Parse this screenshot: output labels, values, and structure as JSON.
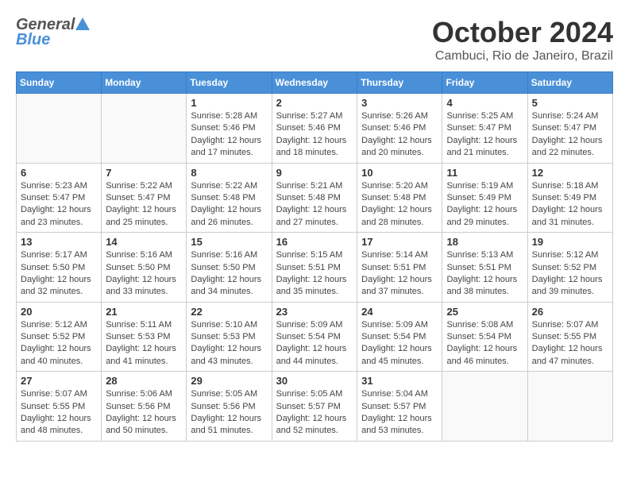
{
  "header": {
    "logo": {
      "general": "General",
      "blue": "Blue"
    },
    "title": "October 2024",
    "location": "Cambuci, Rio de Janeiro, Brazil"
  },
  "calendar": {
    "days": [
      "Sunday",
      "Monday",
      "Tuesday",
      "Wednesday",
      "Thursday",
      "Friday",
      "Saturday"
    ],
    "weeks": [
      [
        {
          "day": "",
          "sunrise": "",
          "sunset": "",
          "daylight": ""
        },
        {
          "day": "",
          "sunrise": "",
          "sunset": "",
          "daylight": ""
        },
        {
          "day": "1",
          "sunrise": "Sunrise: 5:28 AM",
          "sunset": "Sunset: 5:46 PM",
          "daylight": "Daylight: 12 hours and 17 minutes."
        },
        {
          "day": "2",
          "sunrise": "Sunrise: 5:27 AM",
          "sunset": "Sunset: 5:46 PM",
          "daylight": "Daylight: 12 hours and 18 minutes."
        },
        {
          "day": "3",
          "sunrise": "Sunrise: 5:26 AM",
          "sunset": "Sunset: 5:46 PM",
          "daylight": "Daylight: 12 hours and 20 minutes."
        },
        {
          "day": "4",
          "sunrise": "Sunrise: 5:25 AM",
          "sunset": "Sunset: 5:47 PM",
          "daylight": "Daylight: 12 hours and 21 minutes."
        },
        {
          "day": "5",
          "sunrise": "Sunrise: 5:24 AM",
          "sunset": "Sunset: 5:47 PM",
          "daylight": "Daylight: 12 hours and 22 minutes."
        }
      ],
      [
        {
          "day": "6",
          "sunrise": "Sunrise: 5:23 AM",
          "sunset": "Sunset: 5:47 PM",
          "daylight": "Daylight: 12 hours and 23 minutes."
        },
        {
          "day": "7",
          "sunrise": "Sunrise: 5:22 AM",
          "sunset": "Sunset: 5:47 PM",
          "daylight": "Daylight: 12 hours and 25 minutes."
        },
        {
          "day": "8",
          "sunrise": "Sunrise: 5:22 AM",
          "sunset": "Sunset: 5:48 PM",
          "daylight": "Daylight: 12 hours and 26 minutes."
        },
        {
          "day": "9",
          "sunrise": "Sunrise: 5:21 AM",
          "sunset": "Sunset: 5:48 PM",
          "daylight": "Daylight: 12 hours and 27 minutes."
        },
        {
          "day": "10",
          "sunrise": "Sunrise: 5:20 AM",
          "sunset": "Sunset: 5:48 PM",
          "daylight": "Daylight: 12 hours and 28 minutes."
        },
        {
          "day": "11",
          "sunrise": "Sunrise: 5:19 AM",
          "sunset": "Sunset: 5:49 PM",
          "daylight": "Daylight: 12 hours and 29 minutes."
        },
        {
          "day": "12",
          "sunrise": "Sunrise: 5:18 AM",
          "sunset": "Sunset: 5:49 PM",
          "daylight": "Daylight: 12 hours and 31 minutes."
        }
      ],
      [
        {
          "day": "13",
          "sunrise": "Sunrise: 5:17 AM",
          "sunset": "Sunset: 5:50 PM",
          "daylight": "Daylight: 12 hours and 32 minutes."
        },
        {
          "day": "14",
          "sunrise": "Sunrise: 5:16 AM",
          "sunset": "Sunset: 5:50 PM",
          "daylight": "Daylight: 12 hours and 33 minutes."
        },
        {
          "day": "15",
          "sunrise": "Sunrise: 5:16 AM",
          "sunset": "Sunset: 5:50 PM",
          "daylight": "Daylight: 12 hours and 34 minutes."
        },
        {
          "day": "16",
          "sunrise": "Sunrise: 5:15 AM",
          "sunset": "Sunset: 5:51 PM",
          "daylight": "Daylight: 12 hours and 35 minutes."
        },
        {
          "day": "17",
          "sunrise": "Sunrise: 5:14 AM",
          "sunset": "Sunset: 5:51 PM",
          "daylight": "Daylight: 12 hours and 37 minutes."
        },
        {
          "day": "18",
          "sunrise": "Sunrise: 5:13 AM",
          "sunset": "Sunset: 5:51 PM",
          "daylight": "Daylight: 12 hours and 38 minutes."
        },
        {
          "day": "19",
          "sunrise": "Sunrise: 5:12 AM",
          "sunset": "Sunset: 5:52 PM",
          "daylight": "Daylight: 12 hours and 39 minutes."
        }
      ],
      [
        {
          "day": "20",
          "sunrise": "Sunrise: 5:12 AM",
          "sunset": "Sunset: 5:52 PM",
          "daylight": "Daylight: 12 hours and 40 minutes."
        },
        {
          "day": "21",
          "sunrise": "Sunrise: 5:11 AM",
          "sunset": "Sunset: 5:53 PM",
          "daylight": "Daylight: 12 hours and 41 minutes."
        },
        {
          "day": "22",
          "sunrise": "Sunrise: 5:10 AM",
          "sunset": "Sunset: 5:53 PM",
          "daylight": "Daylight: 12 hours and 43 minutes."
        },
        {
          "day": "23",
          "sunrise": "Sunrise: 5:09 AM",
          "sunset": "Sunset: 5:54 PM",
          "daylight": "Daylight: 12 hours and 44 minutes."
        },
        {
          "day": "24",
          "sunrise": "Sunrise: 5:09 AM",
          "sunset": "Sunset: 5:54 PM",
          "daylight": "Daylight: 12 hours and 45 minutes."
        },
        {
          "day": "25",
          "sunrise": "Sunrise: 5:08 AM",
          "sunset": "Sunset: 5:54 PM",
          "daylight": "Daylight: 12 hours and 46 minutes."
        },
        {
          "day": "26",
          "sunrise": "Sunrise: 5:07 AM",
          "sunset": "Sunset: 5:55 PM",
          "daylight": "Daylight: 12 hours and 47 minutes."
        }
      ],
      [
        {
          "day": "27",
          "sunrise": "Sunrise: 5:07 AM",
          "sunset": "Sunset: 5:55 PM",
          "daylight": "Daylight: 12 hours and 48 minutes."
        },
        {
          "day": "28",
          "sunrise": "Sunrise: 5:06 AM",
          "sunset": "Sunset: 5:56 PM",
          "daylight": "Daylight: 12 hours and 50 minutes."
        },
        {
          "day": "29",
          "sunrise": "Sunrise: 5:05 AM",
          "sunset": "Sunset: 5:56 PM",
          "daylight": "Daylight: 12 hours and 51 minutes."
        },
        {
          "day": "30",
          "sunrise": "Sunrise: 5:05 AM",
          "sunset": "Sunset: 5:57 PM",
          "daylight": "Daylight: 12 hours and 52 minutes."
        },
        {
          "day": "31",
          "sunrise": "Sunrise: 5:04 AM",
          "sunset": "Sunset: 5:57 PM",
          "daylight": "Daylight: 12 hours and 53 minutes."
        },
        {
          "day": "",
          "sunrise": "",
          "sunset": "",
          "daylight": ""
        },
        {
          "day": "",
          "sunrise": "",
          "sunset": "",
          "daylight": ""
        }
      ]
    ]
  }
}
